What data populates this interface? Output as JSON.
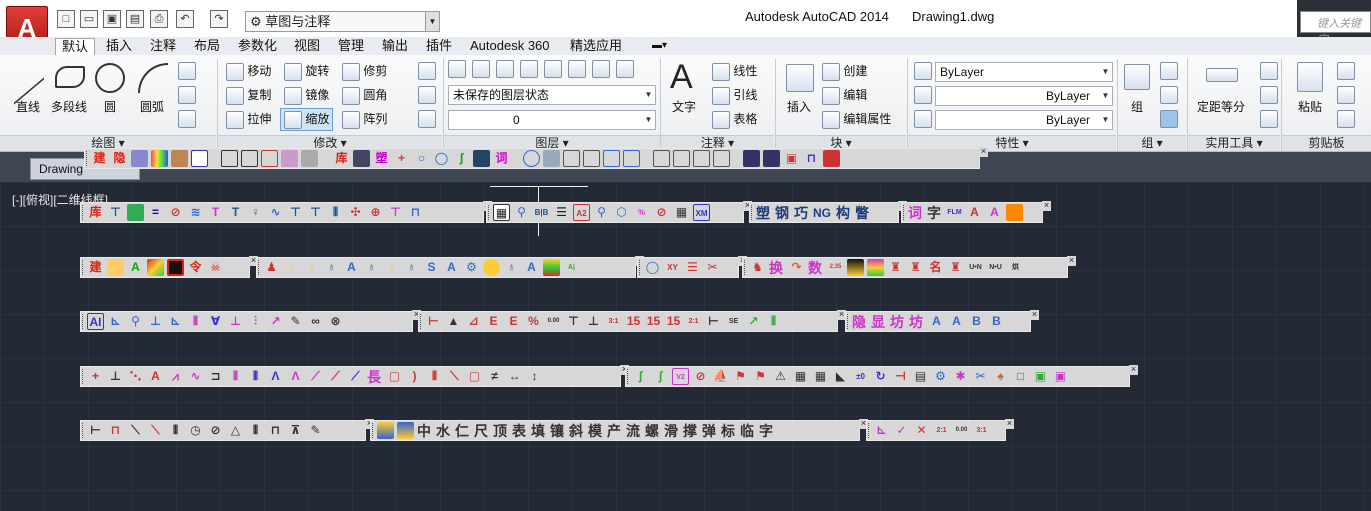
{
  "app": {
    "title": "Autodesk AutoCAD 2014",
    "document": "Drawing1.dwg",
    "logo_letter": "A",
    "workspace": "草图与注释",
    "search_placeholder": "键入关键字"
  },
  "quick_access_icons": [
    "new-icon",
    "open-icon",
    "save-icon",
    "saveas-icon",
    "print-icon",
    "undo-icon",
    "redo-icon"
  ],
  "tabs": [
    "默认",
    "插入",
    "注释",
    "布局",
    "参数化",
    "视图",
    "管理",
    "输出",
    "插件",
    "Autodesk 360",
    "精选应用"
  ],
  "draw_panel": {
    "title": "绘图",
    "buttons": [
      "直线",
      "多段线",
      "圆",
      "圆弧"
    ]
  },
  "modify_panel": {
    "title": "修改",
    "rows": [
      [
        "移动",
        "旋转",
        "修剪"
      ],
      [
        "复制",
        "镜像",
        "圆角"
      ],
      [
        "拉伸",
        "缩放",
        "阵列"
      ]
    ]
  },
  "layers_panel": {
    "title": "图层",
    "state": "未保存的图层状态",
    "current": "0"
  },
  "annotation_panel": {
    "title": "注释",
    "big": "文字",
    "items": [
      "线性",
      "引线",
      "表格"
    ]
  },
  "block_panel": {
    "title": "块",
    "big": "插入",
    "items": [
      "创建",
      "编辑",
      "编辑属性"
    ]
  },
  "properties_panel": {
    "title": "特性",
    "color": "ByLayer",
    "linetype": "ByLayer",
    "lineweight": "ByLayer"
  },
  "groups_panel": {
    "title": "组",
    "big": "组"
  },
  "utilities_panel": {
    "title": "实用工具",
    "big": "定距等分"
  },
  "clipboard_panel": {
    "title": "剪贴板",
    "big": "粘贴"
  },
  "document_tab": {
    "label": "Drawing"
  },
  "viewport_label": "[-][俯视][二维线框]",
  "toolbar_rows": [
    {
      "groups": [
        [
          "建",
          "隐",
          "",
          "",
          "",
          ""
        ],
        [
          "",
          "",
          "",
          "",
          "",
          ""
        ],
        [
          "库",
          "",
          "",
          "",
          "",
          ""
        ]
      ]
    },
    {
      "text": [
        "塑",
        "钢",
        "巧",
        "NG",
        "构",
        "瞥"
      ]
    },
    {
      "text2": [
        "词",
        "字"
      ]
    },
    {
      "text3": [
        "换",
        "数"
      ]
    },
    {
      "text4": [
        "隐",
        "显",
        "坊",
        "坊"
      ]
    },
    {
      "text5": [
        "長"
      ]
    },
    {
      "text6": [
        "中",
        "水",
        "仁",
        "尺",
        "顶",
        "表",
        "填",
        "镶",
        "斜",
        "模",
        "产",
        "流",
        "螺",
        "滑",
        "撑",
        "弹",
        "标",
        "临",
        "字"
      ]
    }
  ],
  "colors": {
    "accent": "#c7281e",
    "canvas": "#232a36"
  }
}
